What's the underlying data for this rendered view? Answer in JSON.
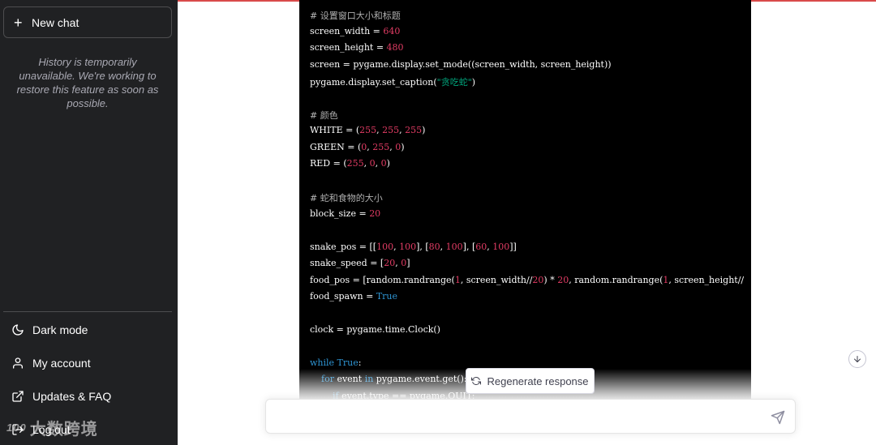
{
  "sidebar": {
    "new_chat_label": "New chat",
    "history_note": "History is temporarily unavailable. We're working to restore this feature as soon as possible.",
    "items": [
      {
        "label": "Dark mode",
        "icon": "moon-icon"
      },
      {
        "label": "My account",
        "icon": "user-icon"
      },
      {
        "label": "Updates & FAQ",
        "icon": "external-link-icon"
      },
      {
        "label": "Log out",
        "icon": "logout-icon"
      }
    ]
  },
  "watermark": {
    "logo": "100",
    "text": "大数跨境"
  },
  "code_lines": [
    {
      "text": "# 设置窗口大小和标题"
    },
    {
      "text": "screen_width = 640"
    },
    {
      "text": "screen_height = 480"
    },
    {
      "text": "screen = pygame.display.set_mode((screen_width, screen_height))"
    },
    {
      "text": "pygame.display.set_caption(\"贪吃蛇\")"
    },
    {
      "text": ""
    },
    {
      "text": "# 颜色"
    },
    {
      "text": "WHITE = (255, 255, 255)"
    },
    {
      "text": "GREEN = (0, 255, 0)"
    },
    {
      "text": "RED = (255, 0, 0)"
    },
    {
      "text": ""
    },
    {
      "text": "# 蛇和食物的大小"
    },
    {
      "text": "block_size = 20"
    },
    {
      "text": ""
    },
    {
      "text": "snake_pos = [[100, 100], [80, 100], [60, 100]]"
    },
    {
      "text": "snake_speed = [20, 0]"
    },
    {
      "text": "food_pos = [random.randrange(1, screen_width//20) * 20, random.randrange(1, screen_height//"
    },
    {
      "text": "food_spawn = True"
    },
    {
      "text": ""
    },
    {
      "text": "clock = pygame.time.Clock()"
    },
    {
      "text": ""
    },
    {
      "text": "while True:"
    },
    {
      "text": "    for event in pygame.event.get():"
    },
    {
      "text": "        if event.type == pygame.QUIT:"
    }
  ],
  "main": {
    "regenerate_label": "Regenerate response",
    "input_placeholder": ""
  },
  "colors": {
    "sidebar_bg": "#202123",
    "code_bg": "#000000",
    "number": "#e23c64",
    "keyword": "#2e95d3",
    "string": "#00a67d",
    "comment": "#b0b0b0",
    "top_accent": "#d94a4a"
  }
}
